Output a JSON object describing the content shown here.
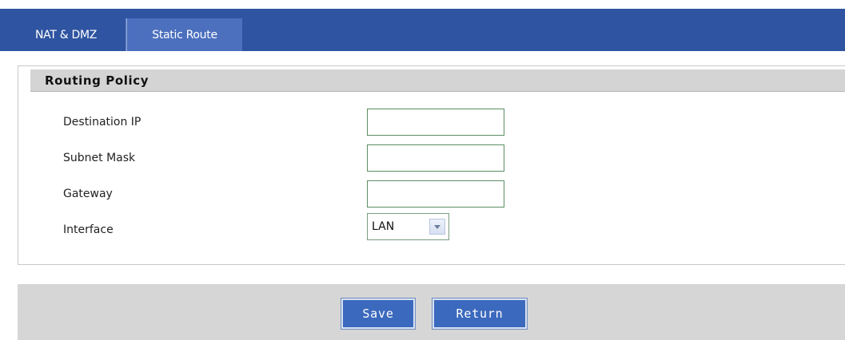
{
  "tabs": [
    {
      "label": "NAT & DMZ",
      "active": true
    },
    {
      "label": "Static Route",
      "active": false
    }
  ],
  "panel": {
    "title": "Routing Policy",
    "fields": {
      "destination_ip": {
        "label": "Destination IP",
        "value": ""
      },
      "subnet_mask": {
        "label": "Subnet Mask",
        "value": ""
      },
      "gateway": {
        "label": "Gateway",
        "value": ""
      },
      "interface": {
        "label": "Interface",
        "value": "LAN",
        "icon": "dropdown-arrow-icon"
      }
    }
  },
  "actions": {
    "save_label": "Save",
    "return_label": "Return"
  },
  "colors": {
    "tabbar": "#2f54a1",
    "button": "#3b69bd",
    "header_bg": "#d4d4d4"
  }
}
